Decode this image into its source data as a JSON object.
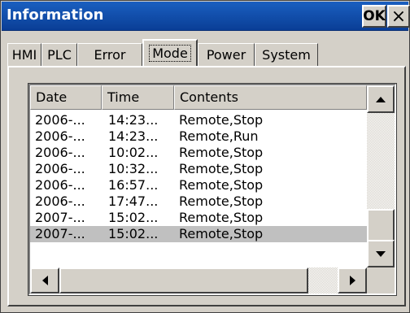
{
  "window": {
    "title": "Information",
    "ok_label": "OK",
    "close_label": "×"
  },
  "tabs": [
    {
      "label": "HMI",
      "active": false
    },
    {
      "label": "PLC",
      "active": false
    },
    {
      "label": "Error",
      "active": false
    },
    {
      "label": "Mode",
      "active": true
    },
    {
      "label": "Power",
      "active": false
    },
    {
      "label": "System",
      "active": false
    }
  ],
  "list": {
    "columns": [
      "Date",
      "Time",
      "Contents"
    ],
    "rows": [
      {
        "date": "2006-...",
        "time": "14:23...",
        "contents": "Remote,Stop",
        "selected": false
      },
      {
        "date": "2006-...",
        "time": "14:23...",
        "contents": "Remote,Run",
        "selected": false
      },
      {
        "date": "2006-...",
        "time": "10:02...",
        "contents": "Remote,Stop",
        "selected": false
      },
      {
        "date": "2006-...",
        "time": "10:32...",
        "contents": "Remote,Stop",
        "selected": false
      },
      {
        "date": "2006-...",
        "time": "16:57...",
        "contents": "Remote,Stop",
        "selected": false
      },
      {
        "date": "2006-...",
        "time": "17:47...",
        "contents": "Remote,Stop",
        "selected": false
      },
      {
        "date": "2007-...",
        "time": "15:02...",
        "contents": "Remote,Stop",
        "selected": false
      },
      {
        "date": "2007-...",
        "time": "15:02...",
        "contents": "Remote,Stop",
        "selected": true
      }
    ]
  },
  "icons": {
    "scroll_up": "up-arrow-icon",
    "scroll_down": "down-arrow-icon",
    "scroll_left": "left-arrow-icon",
    "scroll_right": "right-arrow-icon"
  },
  "colors": {
    "titlebar": "#0a4aa8",
    "face": "#d4d0c8",
    "selected_row": "#c0c0c0"
  }
}
